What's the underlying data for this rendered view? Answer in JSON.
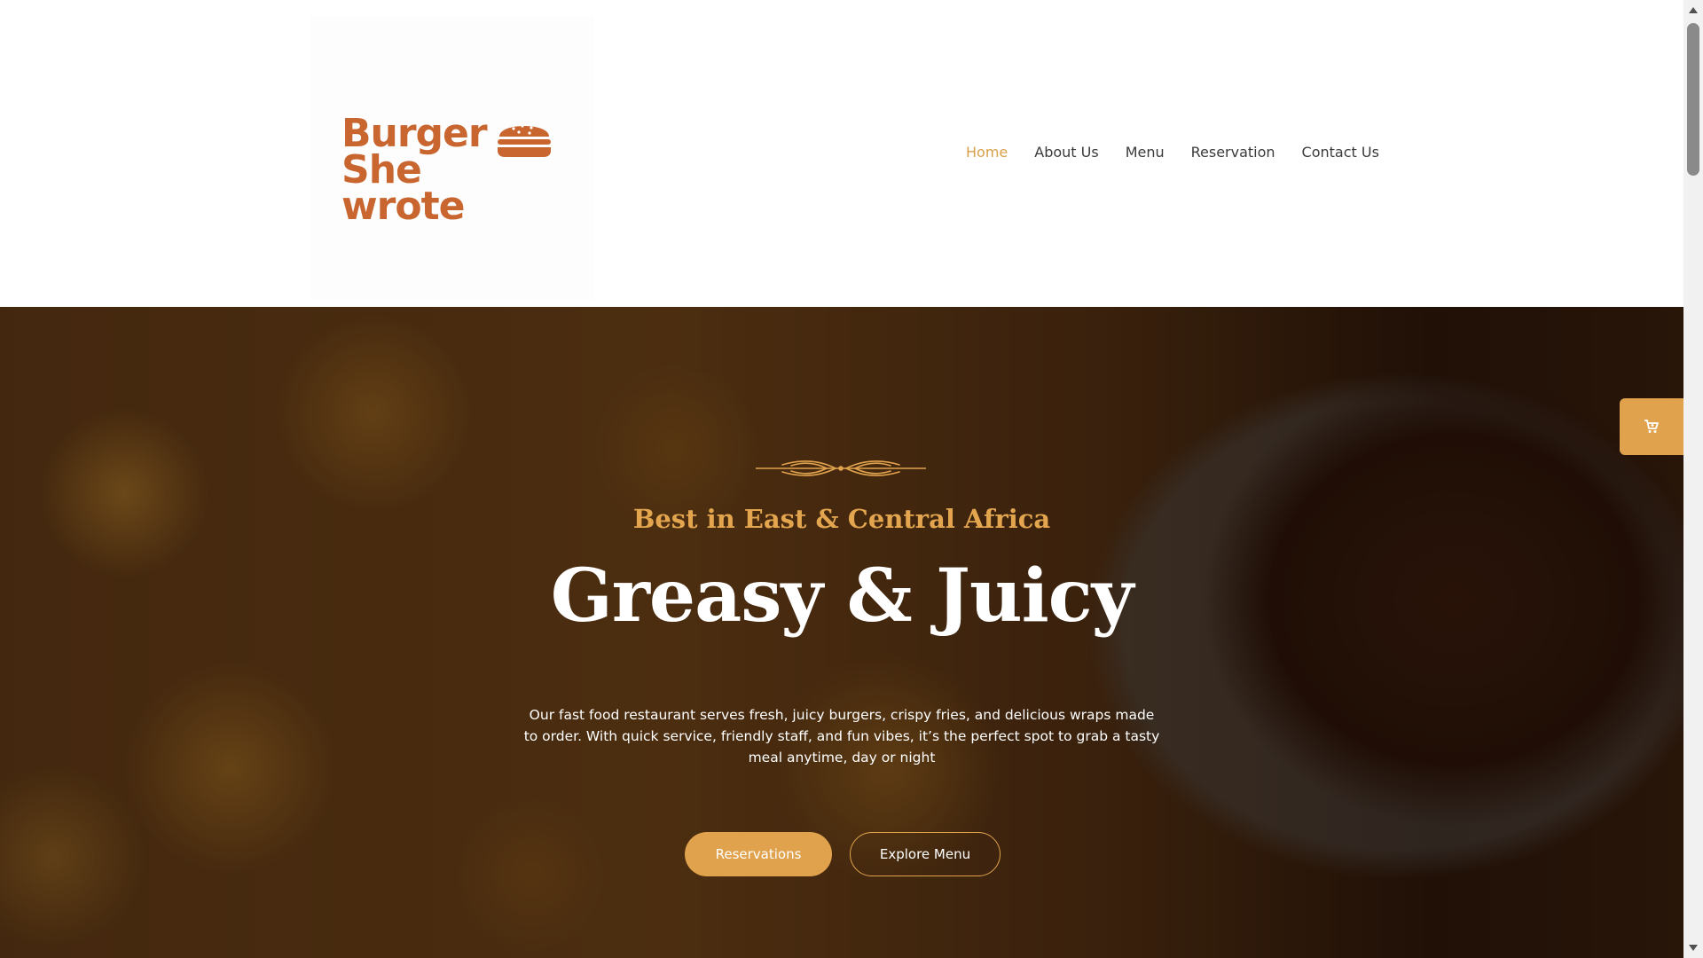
{
  "brand": {
    "logo_text_line1": "Burger",
    "logo_text_line2": "She wrote",
    "color": "#c96630"
  },
  "nav": {
    "items": [
      {
        "label": "Home",
        "active": true
      },
      {
        "label": "About Us",
        "active": false
      },
      {
        "label": "Menu",
        "active": false
      },
      {
        "label": "Reservation",
        "active": false
      },
      {
        "label": "Contact Us",
        "active": false
      }
    ],
    "active_color": "#d9a04a"
  },
  "hero": {
    "subtitle": "Best in East & Central Africa",
    "title": "Greasy & Juicy",
    "description": "Our fast food restaurant serves fresh, juicy burgers, crispy fries, and delicious wraps made to order. With quick service, friendly staff, and fun vibes, it’s the perfect spot to grab a tasty meal anytime, day or night",
    "primary_button": "Reservations",
    "secondary_button": "Explore Menu",
    "accent_color": "#e0a24c"
  },
  "cart": {
    "icon": "cart-icon"
  }
}
